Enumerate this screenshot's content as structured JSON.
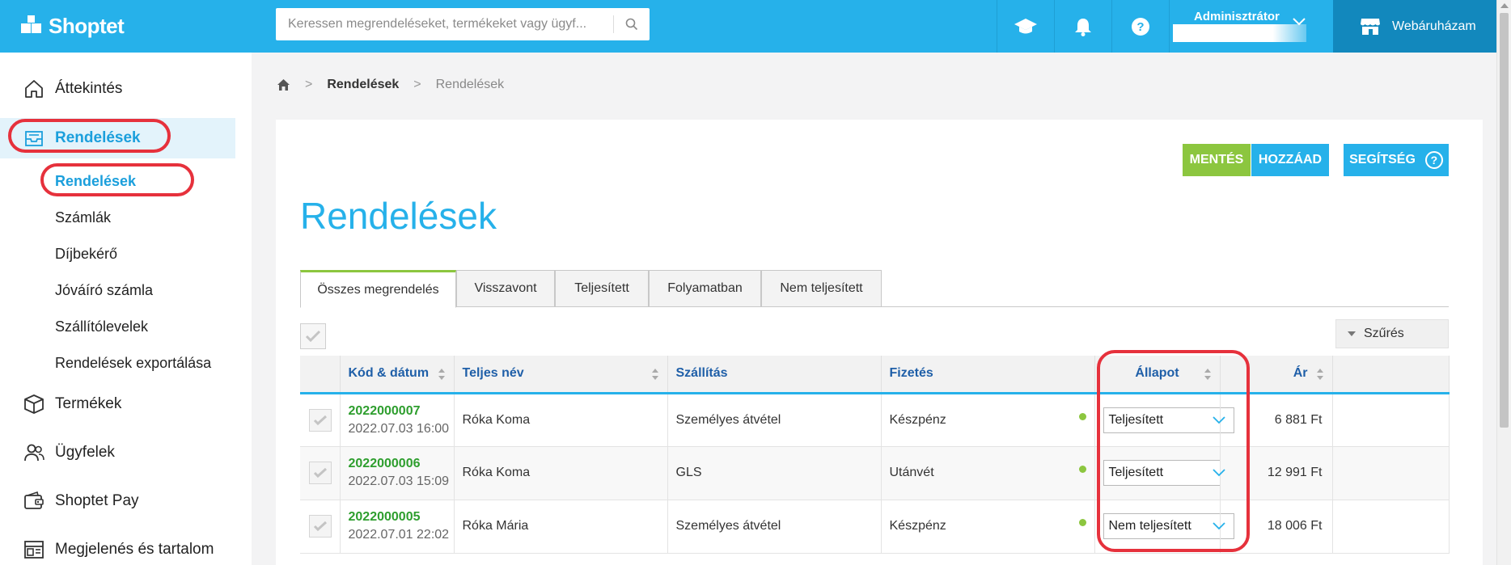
{
  "app": {
    "logo_text": "Shoptet",
    "search_placeholder": "Keressen megrendeléseket, termékeket vagy ügyf...",
    "admin_label": "Adminisztrátor",
    "shop_button": "Webáruházam",
    "accent_color": "#26b1ea"
  },
  "sidebar": {
    "items": [
      {
        "label": "Áttekintés",
        "icon": "home-icon"
      },
      {
        "label": "Rendelések",
        "icon": "inbox-icon"
      },
      {
        "label": "Termékek",
        "icon": "box-icon"
      },
      {
        "label": "Ügyfelek",
        "icon": "users-icon"
      },
      {
        "label": "Shoptet Pay",
        "icon": "wallet-icon"
      },
      {
        "label": "Megjelenés és tartalom",
        "icon": "layout-icon"
      }
    ],
    "sub_items": [
      {
        "label": "Rendelések"
      },
      {
        "label": "Számlák"
      },
      {
        "label": "Díjbekérő"
      },
      {
        "label": "Jóváíró számla"
      },
      {
        "label": "Szállítólevelek"
      },
      {
        "label": "Rendelések exportálása"
      }
    ]
  },
  "breadcrumb": {
    "level1": "Rendelések",
    "level2": "Rendelések"
  },
  "toolbar": {
    "save_label": "MENTÉS",
    "add_label": "HOZZÁAD",
    "help_label": "SEGÍTSÉG",
    "help_symbol": "?"
  },
  "page": {
    "title": "Rendelések",
    "filter_label": "Szűrés"
  },
  "tabs": [
    {
      "label": "Összes megrendelés"
    },
    {
      "label": "Visszavont"
    },
    {
      "label": "Teljesített"
    },
    {
      "label": "Folyamatban"
    },
    {
      "label": "Nem teljesített"
    }
  ],
  "table": {
    "columns": {
      "code": "Kód & dátum",
      "name": "Teljes név",
      "shipping": "Szállítás",
      "payment": "Fizetés",
      "status": "Állapot",
      "price": "Ár"
    },
    "rows": [
      {
        "code": "2022000007",
        "date": "2022.07.03 16:00",
        "name": "Róka Koma",
        "shipping": "Személyes átvétel",
        "payment": "Készpénz",
        "status": "Teljesített",
        "price": "6 881 Ft"
      },
      {
        "code": "2022000006",
        "date": "2022.07.03 15:09",
        "name": "Róka Koma",
        "shipping": "GLS",
        "payment": "Utánvét",
        "status": "Teljesített",
        "price": "12 991 Ft"
      },
      {
        "code": "2022000005",
        "date": "2022.07.01 22:02",
        "name": "Róka Mária",
        "shipping": "Személyes átvétel",
        "payment": "Készpénz",
        "status": "Nem teljesített",
        "price": "18 006 Ft"
      }
    ]
  }
}
